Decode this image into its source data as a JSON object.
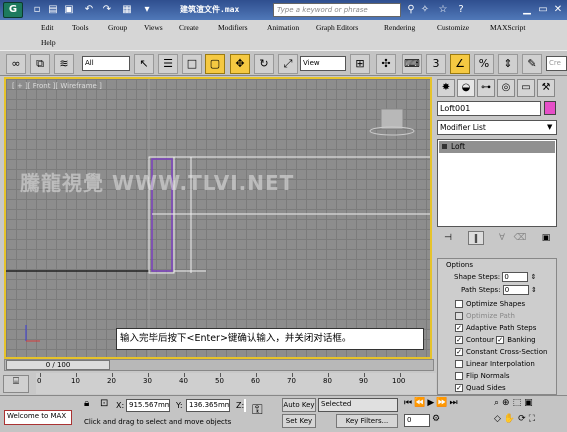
{
  "app": {
    "icon_label": "G",
    "title": "建筑渲文件.max"
  },
  "search": {
    "placeholder": "Type a keyword or phrase"
  },
  "menu": [
    "Edit",
    "Tools",
    "Group",
    "Views",
    "Create",
    "Modifiers",
    "Animation",
    "Graph Editors",
    "Rendering",
    "Customize",
    "MAXScript",
    "Help"
  ],
  "toolbar": {
    "filter_value": "All",
    "refcoord_value": "View"
  },
  "viewport": {
    "label": "[ + ][ Front ][ Wireframe ]",
    "watermark": "騰龍視覺 WWW.TLVI.NET",
    "caption": "输入完毕后按下<Enter>键确认输入，并关闭对话框。"
  },
  "command_panel": {
    "object_name": "Loft001",
    "modifier_list": "Modifier List",
    "stack_item": "Loft",
    "options": {
      "title": "Options",
      "shape_steps_label": "Shape Steps:",
      "shape_steps": "0",
      "path_steps_label": "Path Steps:",
      "path_steps": "0",
      "optimize_shapes": "Optimize Shapes",
      "optimize_path": "Optimize Path",
      "adaptive_path_steps": "Adaptive Path Steps",
      "contour": "Contour",
      "banking": "Banking",
      "constant_cross_section": "Constant Cross-Section",
      "linear_interpolation": "Linear Interpolation",
      "flip_normals": "Flip Normals",
      "quad_sides": "Quad Sides"
    }
  },
  "timeline": {
    "slider_label": "0 / 100",
    "ticks": [
      "0",
      "10",
      "20",
      "30",
      "40",
      "50",
      "60",
      "70",
      "80",
      "90",
      "100"
    ]
  },
  "status": {
    "script_listener": "Welcome to MAX",
    "x_label": "X:",
    "x_value": "915.567mm",
    "y_label": "Y:",
    "y_value": "136.365mm",
    "z_label": "Z:",
    "auto_key": "Auto Key",
    "selected": "Selected",
    "set_key": "Set Key",
    "key_filters": "Key Filters...",
    "prompt": "Click and drag to select and move objects",
    "frame": "0"
  }
}
